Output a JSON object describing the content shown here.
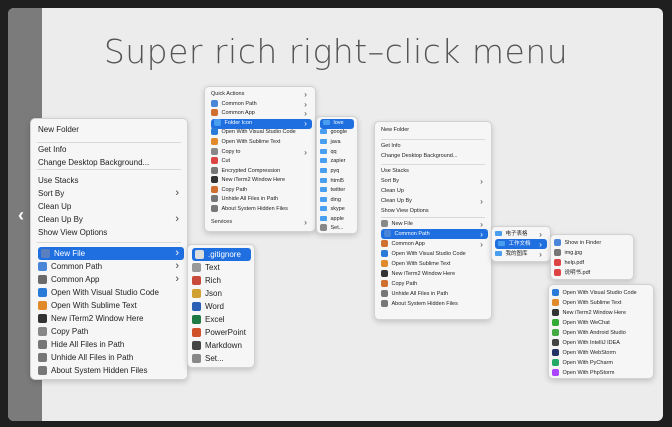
{
  "title": "Super rich right–click menu",
  "menuA": {
    "items": [
      "New Folder",
      "Get Info",
      "Change Desktop Background...",
      "Use Stacks",
      "Sort By",
      "Clean Up",
      "Clean Up By",
      "Show View Options",
      "New File",
      "Common Path",
      "Common App",
      "Open With Visual Studio Code",
      "Open With Sublime Text",
      "New iTerm2 Window Here",
      "Copy Path",
      "Hide All Files in Path",
      "Unhide All Files in Path",
      "About System Hidden Files"
    ]
  },
  "submenuA": {
    "items": [
      ".gitignore",
      "Text",
      "Rich",
      "Json",
      "Word",
      "Excel",
      "PowerPoint",
      "Markdown",
      "Set..."
    ]
  },
  "menuB": {
    "items": [
      "Quick Actions",
      "Common Path",
      "Common App",
      "Folder Icon",
      "Open With Visual Studio Code",
      "Open With Sublime Text",
      "Copy to",
      "Cut",
      "Encrypted Compression",
      "New iTerm2 Window Here",
      "Copy Path",
      "Unhide All Files in Path",
      "About System Hidden Files",
      "Services"
    ]
  },
  "submenuB": {
    "items": [
      "love",
      "google",
      "java",
      "qq",
      "zapier",
      "pyq",
      "html5",
      "twitter",
      "ding",
      "skype",
      "apple",
      "Set..."
    ]
  },
  "menuC": {
    "items": [
      "New Folder",
      "Get Info",
      "Change Desktop Background...",
      "Use Stacks",
      "Sort By",
      "Clean Up",
      "Clean Up By",
      "Show View Options",
      "New File",
      "Common Path",
      "Common App",
      "Open With Visual Studio Code",
      "Open With Sublime Text",
      "New iTerm2 Window Here",
      "Copy Path",
      "Unhide All Files in Path",
      "About System Hidden Files"
    ]
  },
  "submenuC": {
    "items": [
      "电子表格",
      "工作文档",
      "我的图库"
    ]
  },
  "submenuC2": {
    "items": [
      "Show in Finder",
      "img.jpg",
      "help.pdf",
      "说明书.pdf"
    ]
  },
  "submenuC3": {
    "items": [
      "Open With Visual Studio Code",
      "Open With Sublime Text",
      "New iTerm2 Window Here",
      "Open With WeChat",
      "Open With Android Studio",
      "Open With IntelliJ IDEA",
      "Open With WebStorm",
      "Open With PyCharm",
      "Open With PhpStorm"
    ]
  }
}
